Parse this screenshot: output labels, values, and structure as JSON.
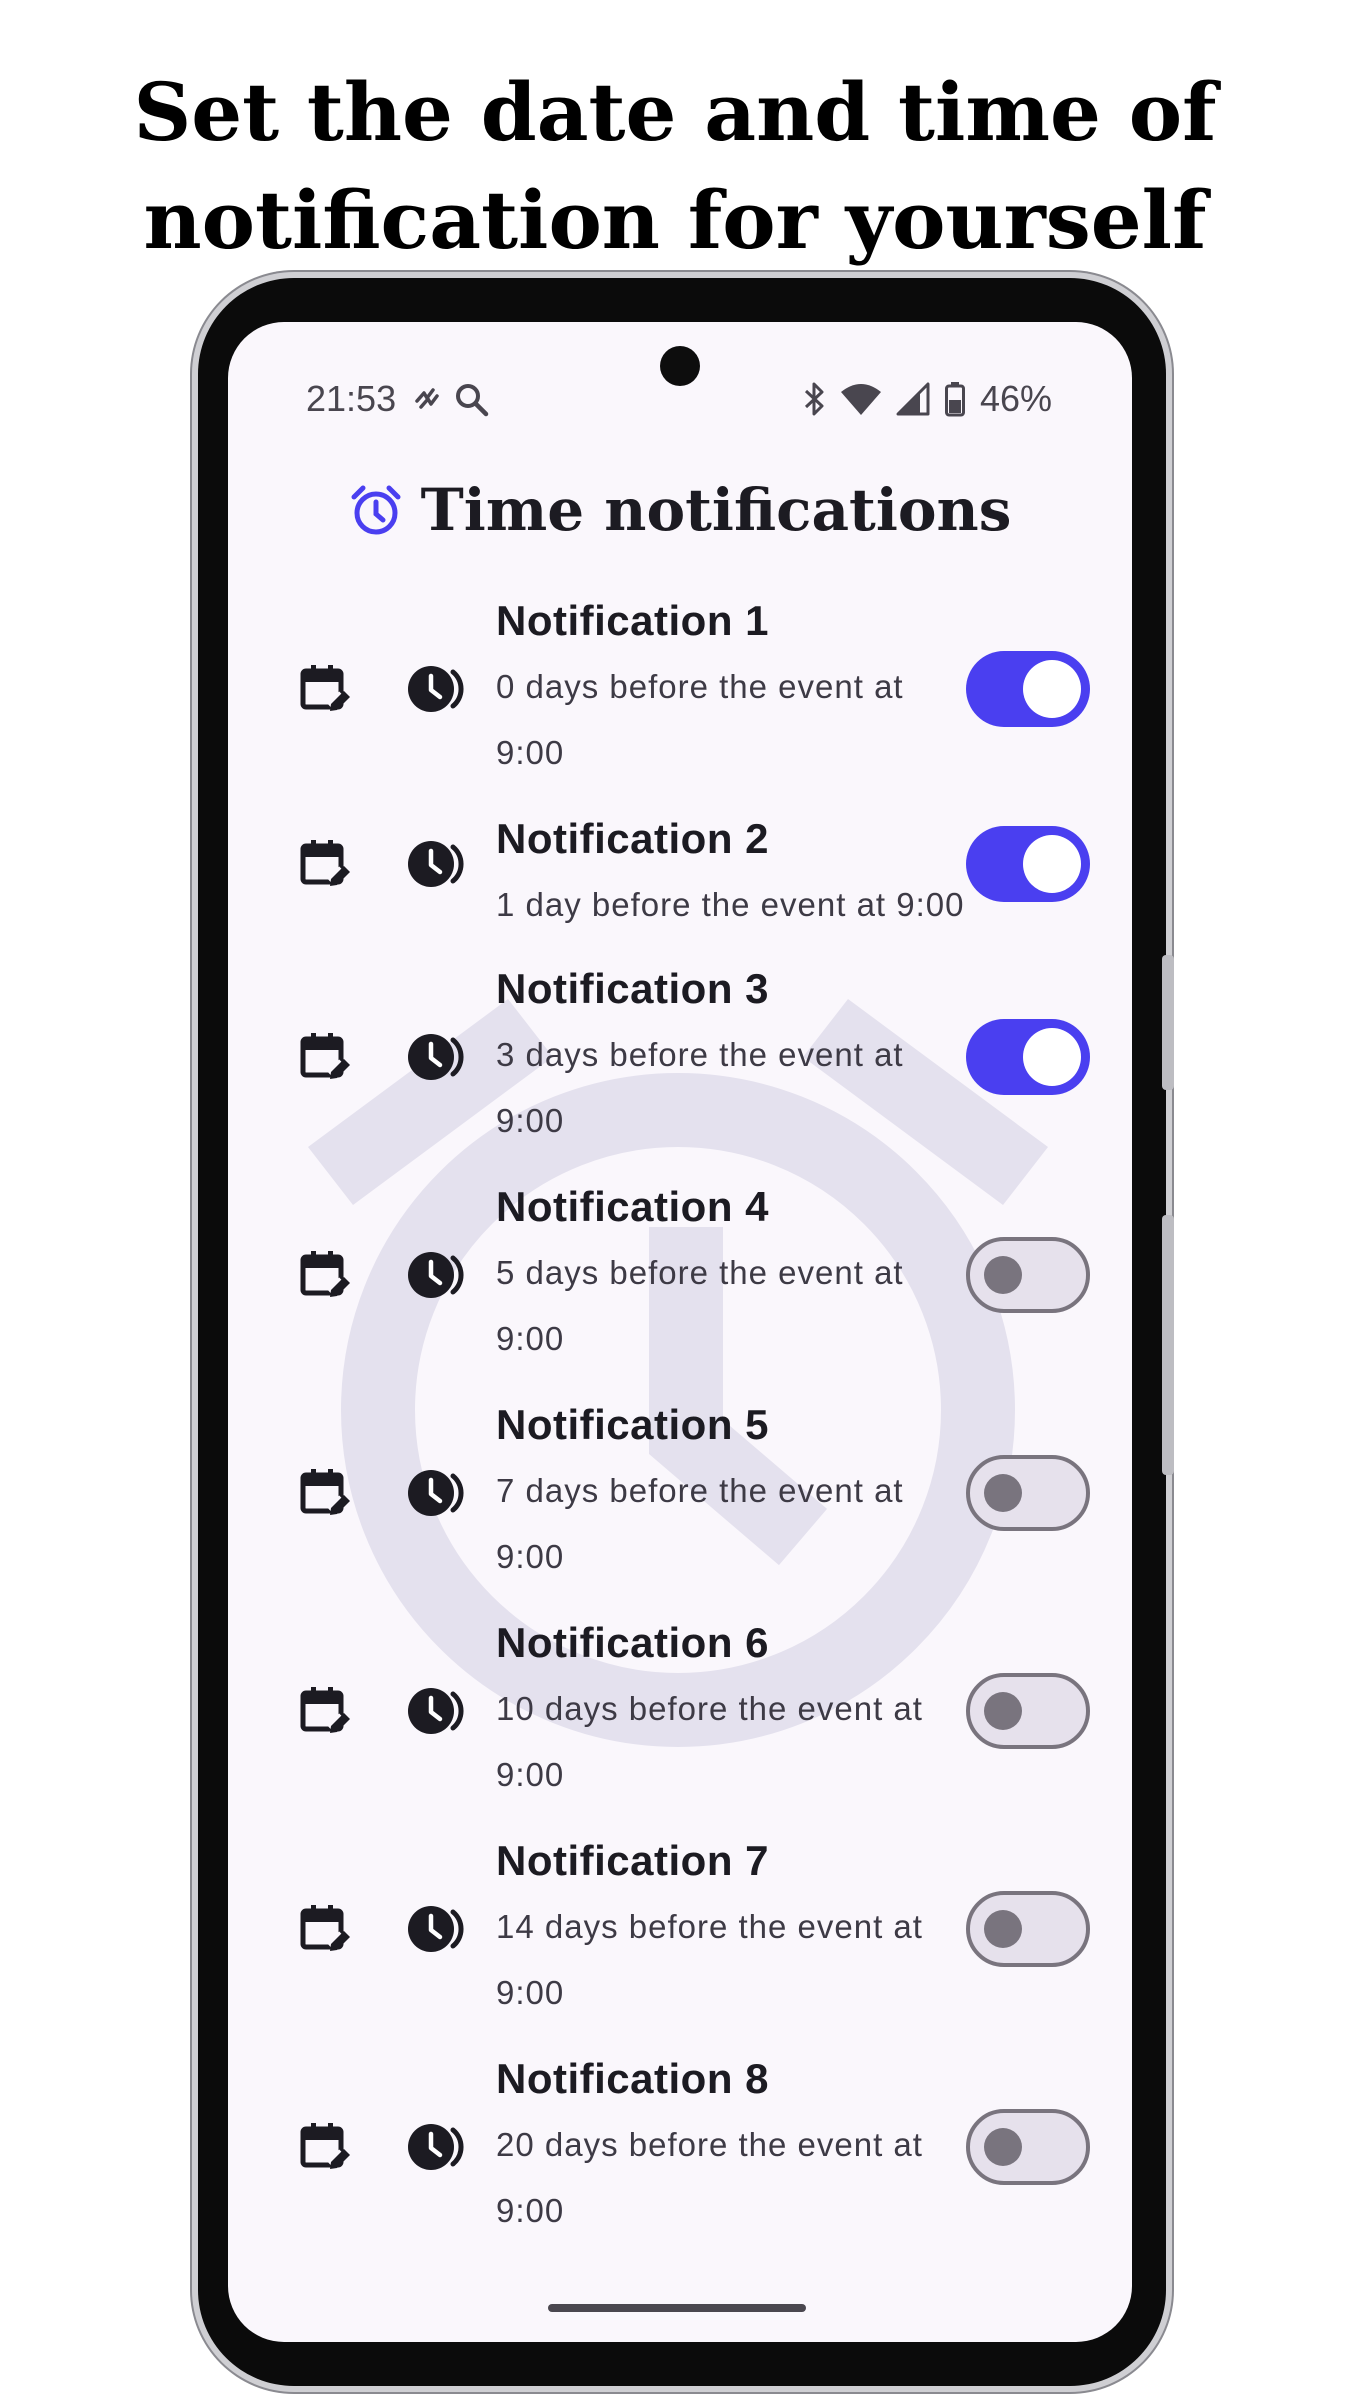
{
  "promo": {
    "title_line1": "Set the date and time of",
    "title_line2": "notification for yourself"
  },
  "status_bar": {
    "time": "21:53",
    "battery": "46%",
    "left_icons": [
      "activity-icon",
      "search-icon"
    ],
    "right_icons": [
      "bluetooth-icon",
      "wifi-icon",
      "cell-signal-icon",
      "battery-icon"
    ]
  },
  "header": {
    "icon": "alarm-clock-icon",
    "title": "Time notifications",
    "accent_color": "#4a3ff0"
  },
  "notifications": [
    {
      "title": "Notification 1",
      "line1": "0 days before the event at",
      "line2": "9:00",
      "enabled": true
    },
    {
      "title": "Notification 2",
      "line1": "1 day before the event at 9:00",
      "line2": "",
      "enabled": true
    },
    {
      "title": "Notification 3",
      "line1": "3 days before the event at",
      "line2": "9:00",
      "enabled": true
    },
    {
      "title": "Notification 4",
      "line1": "5 days before the event at",
      "line2": "9:00",
      "enabled": false
    },
    {
      "title": "Notification 5",
      "line1": "7 days before the event at",
      "line2": "9:00",
      "enabled": false
    },
    {
      "title": "Notification 6",
      "line1": "10 days before the event at",
      "line2": "9:00",
      "enabled": false
    },
    {
      "title": "Notification 7",
      "line1": "14 days before the event at",
      "line2": "9:00",
      "enabled": false
    },
    {
      "title": "Notification 8",
      "line1": "20 days before the event at",
      "line2": "9:00",
      "enabled": false
    }
  ],
  "row_icons": {
    "date": "calendar-edit-icon",
    "time": "clock-schedule-icon"
  },
  "colors": {
    "toggle_on": "#4a3ff0",
    "toggle_off_track": "#e6e1ec",
    "toggle_off_outline": "#79747e",
    "watermark": "#e4e1ee"
  }
}
